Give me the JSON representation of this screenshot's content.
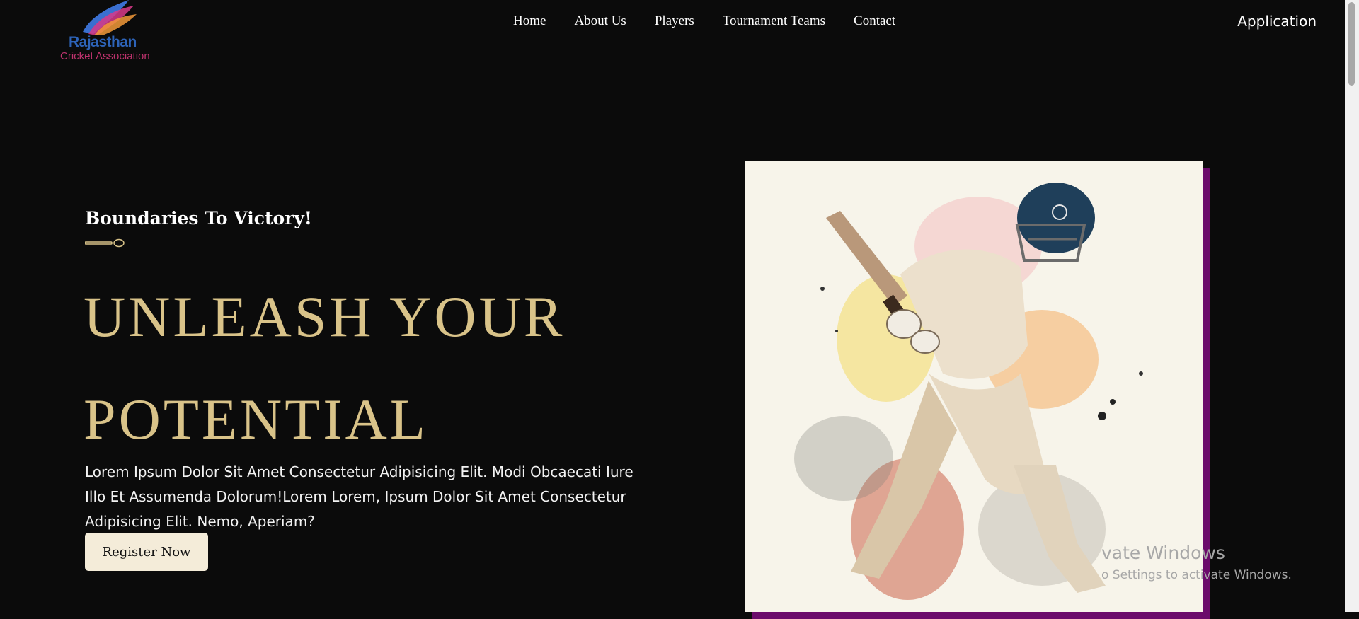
{
  "logo": {
    "name": "Rajasthan",
    "subtitle": "Cricket Association"
  },
  "nav": {
    "items": [
      "Home",
      "About Us",
      "Players",
      "Tournament Teams",
      "Contact"
    ],
    "application": "Application"
  },
  "hero": {
    "tagline": "Boundaries To Victory!",
    "headline_line1": "UNLEASH YOUR",
    "headline_line2": "POTENTIAL",
    "body": "Lorem Ipsum Dolor Sit Amet Consectetur Adipisicing Elit. Modi Obcaecati Iure Illo Et Assumenda Dolorum!Lorem Lorem, Ipsum Dolor Sit Amet Consectetur Adipisicing Elit. Nemo, Aperiam?",
    "button_label": "Register Now",
    "image_icon": "cricket-batsman-watercolor"
  },
  "watermark": {
    "title": "vate Windows",
    "subtitle": "o Settings to activate Windows."
  },
  "colors": {
    "background": "#0b0b0b",
    "headline": "#d9c389",
    "button_bg": "#f4ecd9",
    "glow": "#6b0b6b"
  }
}
